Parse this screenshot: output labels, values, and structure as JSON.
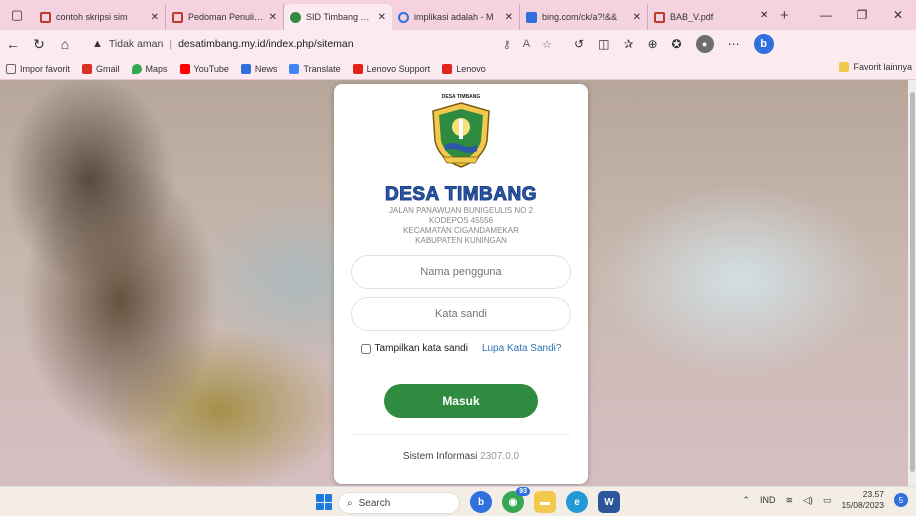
{
  "browser": {
    "tabs": [
      {
        "title": "contoh skripsi sim",
        "icon_color": "#c0392b",
        "active": false
      },
      {
        "title": "Pedoman Penulisan",
        "icon_color": "#c0392b",
        "active": false
      },
      {
        "title": "SID Timbang Desa",
        "icon_color": "#2e8b3f",
        "active": true
      },
      {
        "title": "implikasi adalah - M",
        "icon_color": "#2f6fde",
        "active": false
      },
      {
        "title": "bing.com/ck/a?!&&",
        "icon_color": "#2f6fde",
        "active": false
      },
      {
        "title": "BAB_V.pdf",
        "icon_color": "#c0392b",
        "active": false
      }
    ],
    "close_glyph": "✕",
    "new_tab_glyph": "+",
    "address": {
      "security_label": "Tidak aman",
      "separator": "|",
      "url": "desatimbang.my.id/index.php/siteman"
    },
    "favorites": [
      {
        "label": "Impor favorit",
        "color": "#666"
      },
      {
        "label": "Gmail",
        "color": "#d93025"
      },
      {
        "label": "Maps",
        "color": "#34a853"
      },
      {
        "label": "YouTube",
        "color": "#ff0000"
      },
      {
        "label": "News",
        "color": "#2f6fde"
      },
      {
        "label": "Translate",
        "color": "#4285f4"
      },
      {
        "label": "Lenovo Support",
        "color": "#e2231a"
      },
      {
        "label": "Lenovo",
        "color": "#e2231a"
      }
    ],
    "favorites_folder": "Favorit lainnya",
    "bing_letter": "b"
  },
  "login": {
    "emblem_title": "DESA TIMBANG",
    "village_name": "DESA TIMBANG",
    "address_lines": [
      "JALAN PANAWUAN BUNIGEULIS NO 2",
      "KODEPOS 45556",
      "KECAMATAN CIGANDAMEKAR",
      "KABUPATEN KUNINGAN"
    ],
    "username_placeholder": "Nama pengguna",
    "password_placeholder": "Kata sandi",
    "show_password_label": "Tampilkan kata sandi",
    "forgot_password_label": "Lupa Kata Sandi?",
    "submit_label": "Masuk",
    "footer_label": "Sistem Informasi",
    "footer_version": "2307.0.0"
  },
  "taskbar": {
    "search_label": "Search",
    "chat_badge": "93",
    "tray_lang": "IND",
    "time": "23.57",
    "date": "15/08/2023",
    "notification_count": "5"
  },
  "colors": {
    "tab_bar": "#f5d2df",
    "primary_green": "#2e8b3f",
    "title_blue": "#2b58a8",
    "link_blue": "#2f74b5"
  }
}
